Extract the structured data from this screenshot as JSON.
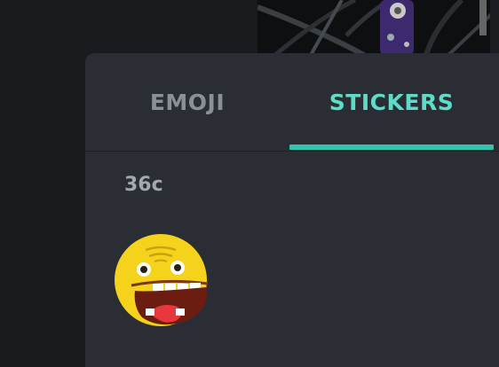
{
  "tabs": {
    "emoji_label": "EMOJI",
    "stickers_label": "STICKERS",
    "active": "stickers"
  },
  "pack": {
    "title": "36c",
    "stickers": [
      {
        "icon": "grinning-face-sticker-icon"
      }
    ]
  },
  "colors": {
    "panel_bg": "#2a2d33",
    "page_bg": "#1a1b1e",
    "active_tab": "#5fdcc8",
    "accent_underline": "#33c4ad",
    "inactive_tab": "#8a8f98",
    "sticker_face": "#f5d21c"
  }
}
